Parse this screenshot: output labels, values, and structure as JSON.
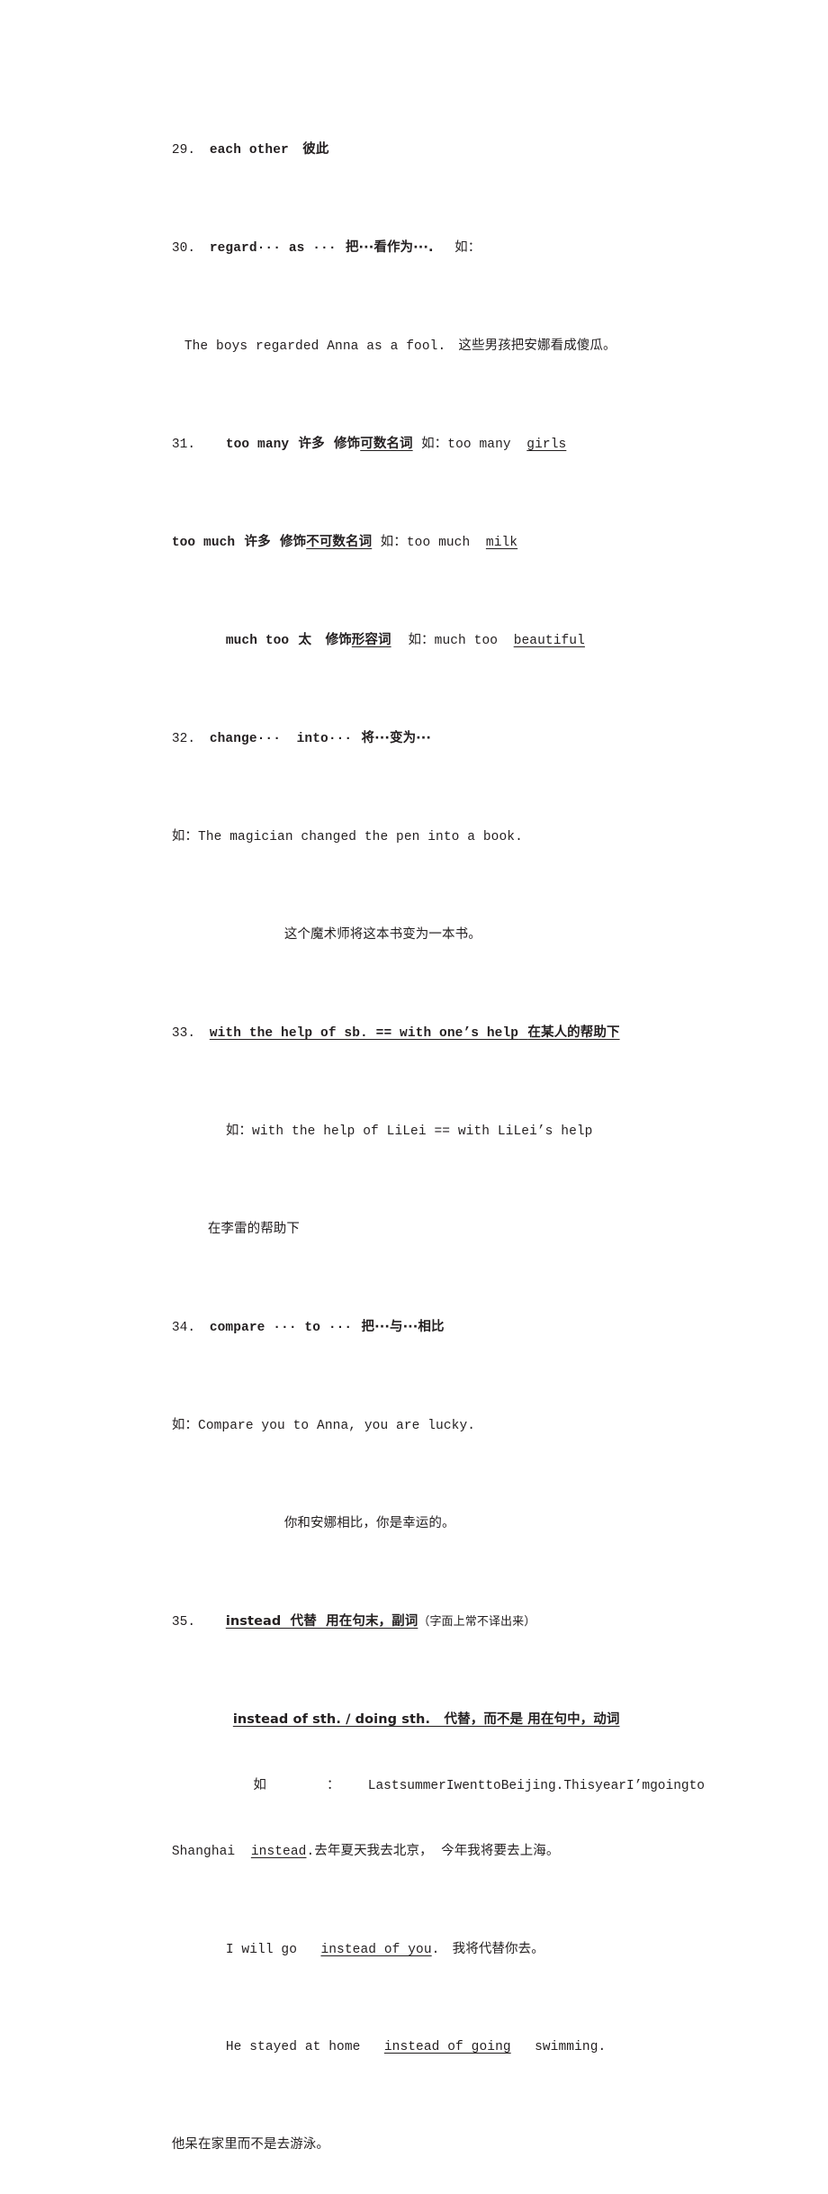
{
  "document": {
    "type": "english-grammar-study-notes",
    "page_background": "#ffffff",
    "text_color": "#231f20",
    "entries": [
      {
        "number": "29.",
        "term": "each other",
        "meaning": "彼此"
      },
      {
        "number": "30.",
        "term": "regard··· as ···",
        "meaning": "把···看作为···.",
        "example_marker": "如：",
        "example_en": "The boys regarded Anna as a fool.",
        "example_cn": "这些男孩把安娜看成傻瓜。"
      },
      {
        "number": "31.",
        "rows": [
          {
            "term": "too many",
            "meaning": "许多",
            "usage_plain": "修饰",
            "usage_underlined": "可数名词",
            "example_marker": "如：",
            "example_prefix": "too many",
            "example_underlined": "girls"
          },
          {
            "term": "too much",
            "meaning": "许多",
            "usage_plain": "修饰",
            "usage_underlined": "不可数名词",
            "example_marker": "如：",
            "example_prefix": "too much",
            "example_underlined": "milk"
          },
          {
            "term": "much too",
            "meaning": "太",
            "usage_plain": "修饰",
            "usage_underlined": "形容词",
            "example_marker": "如：",
            "example_prefix": "much too",
            "example_underlined": "beautiful"
          }
        ]
      },
      {
        "number": "32.",
        "term": "change···  into···",
        "meaning": "将···变为···",
        "example_marker": "如：",
        "example_en": "The magician changed the pen into a book.",
        "example_cn": "这个魔术师将这本书变为一本书。"
      },
      {
        "number": "33.",
        "heading_en": "with the help of sb. == with one’s help",
        "heading_cn": "在某人的帮助下",
        "example_marker": "如：",
        "example_en": "with the help of LiLei == with LiLei’s help",
        "example_cn": "在李雷的帮助下"
      },
      {
        "number": "34.",
        "term": "compare ··· to ···",
        "meaning": "把···与···相比",
        "example_marker": "如：",
        "example_en": "Compare you to Anna, you are lucky.",
        "example_cn": "你和安娜相比，你是幸运的。"
      },
      {
        "number": "35.",
        "heading1_underlined": "instead  代替  用在句末，副词",
        "heading1_note": "（字面上常不译出来）",
        "heading2_underlined": "instead of sth. / doing sth.   代替，而不是 用在句中，动词",
        "example_marker": "如 ：",
        "example1_words": [
          "Last",
          "summer",
          "I",
          "went",
          "to",
          "Beijing.",
          "This",
          "year",
          "I",
          "’",
          "m",
          "going",
          "to"
        ],
        "example1_line2_prefix": "Shanghai",
        "example1_line2_underlined": "instead",
        "example1_line2_suffix": ".",
        "example1_cn": "去年夏天我去北京，  今年我将要去上海。",
        "example2_prefix": "I will go",
        "example2_underlined": "instead of you",
        "example2_suffix": ".",
        "example2_cn": "我将代替你去。",
        "example3_prefix": "He stayed at home",
        "example3_underlined": "instead of going",
        "example3_suffix": "swimming.",
        "example3_cn": "他呆在家里而不是去游泳。"
      }
    ]
  }
}
